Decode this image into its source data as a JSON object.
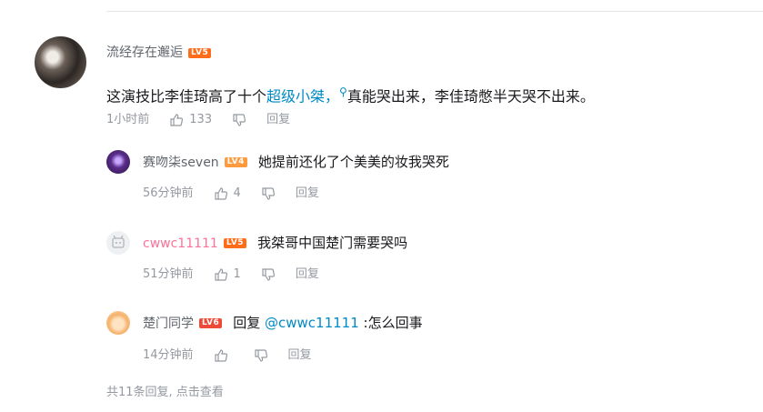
{
  "root": {
    "username": "流经存在邂逅",
    "level": "LV5",
    "content_prefix": "这演技比李佳琦高了十个",
    "content_link": "超级小桀，",
    "content_search_glyph": "⚲",
    "content_suffix": "真能哭出来，李佳琦憋半天哭不出来。",
    "time": "1小时前",
    "likes": "133",
    "reply_label": "回复"
  },
  "replies": [
    {
      "username": "赛吻柒seven",
      "level": "LV4",
      "content": "她提前还化了个美美的妆我哭死",
      "time": "56分钟前",
      "likes": "4",
      "reply_label": "回复"
    },
    {
      "username": "cwwc11111",
      "level": "LV5",
      "content": "我桀哥中国楚门需要哭吗",
      "time": "51分钟前",
      "likes": "1",
      "reply_label": "回复"
    },
    {
      "username": "楚门同学",
      "level": "LV6",
      "content_prefix": "回复 ",
      "content_mention": "@cwwc11111",
      "content_suffix": " :怎么回事",
      "time": "14分钟前",
      "likes": "",
      "reply_label": "回复"
    }
  ],
  "footer": {
    "more_text": "共11条回复, 点击查看"
  },
  "colors": {
    "link": "#008ac5",
    "level_orange": "#ff7e29",
    "level_red": "#ee672a",
    "muted": "#9499a0"
  }
}
